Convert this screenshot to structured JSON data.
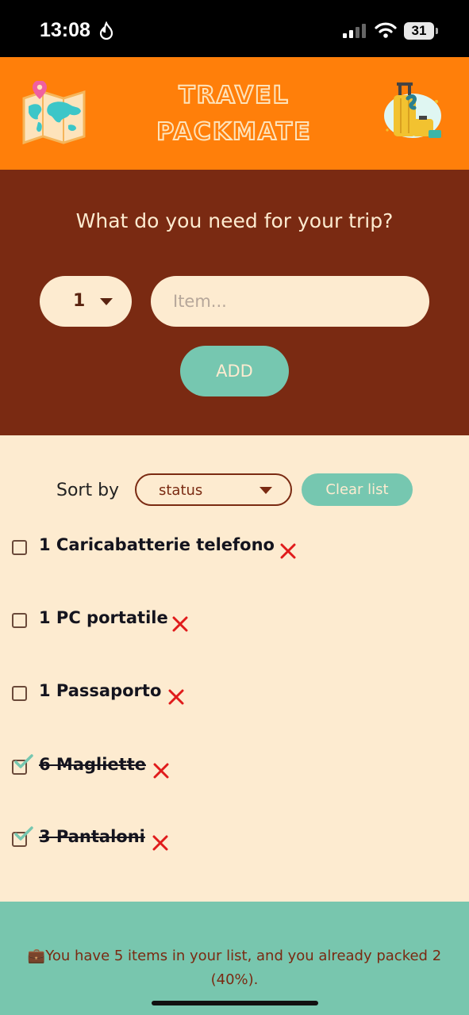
{
  "status_bar": {
    "time": "13:08",
    "battery": "31"
  },
  "header": {
    "title_line1": "TRAVEL",
    "title_line2": "PACKMATE",
    "left_icon": "world-map-icon",
    "right_icon": "luggage-icon"
  },
  "form": {
    "heading": "What do you need for your trip?",
    "quantity": "1",
    "item_placeholder": "Item...",
    "add_label": "ADD"
  },
  "list": {
    "sort_label": "Sort by",
    "sort_value": "status",
    "clear_label": "Clear list",
    "items": [
      {
        "text": "1 Caricabatterie telefono",
        "packed": false
      },
      {
        "text": "1 PC portatile",
        "packed": false
      },
      {
        "text": "1 Passaporto",
        "packed": false
      },
      {
        "text": "6 Magliette",
        "packed": true
      },
      {
        "text": "3 Pantaloni",
        "packed": true
      }
    ]
  },
  "footer": {
    "stats_text": "💼You have 5 items in your list, and you already packed 2 (40%)."
  },
  "colors": {
    "header_bg": "#ff7f0a",
    "form_bg": "#7a2a12",
    "list_bg": "#fdebd0",
    "accent": "#76c7b0",
    "remove": "#e01b1b"
  }
}
